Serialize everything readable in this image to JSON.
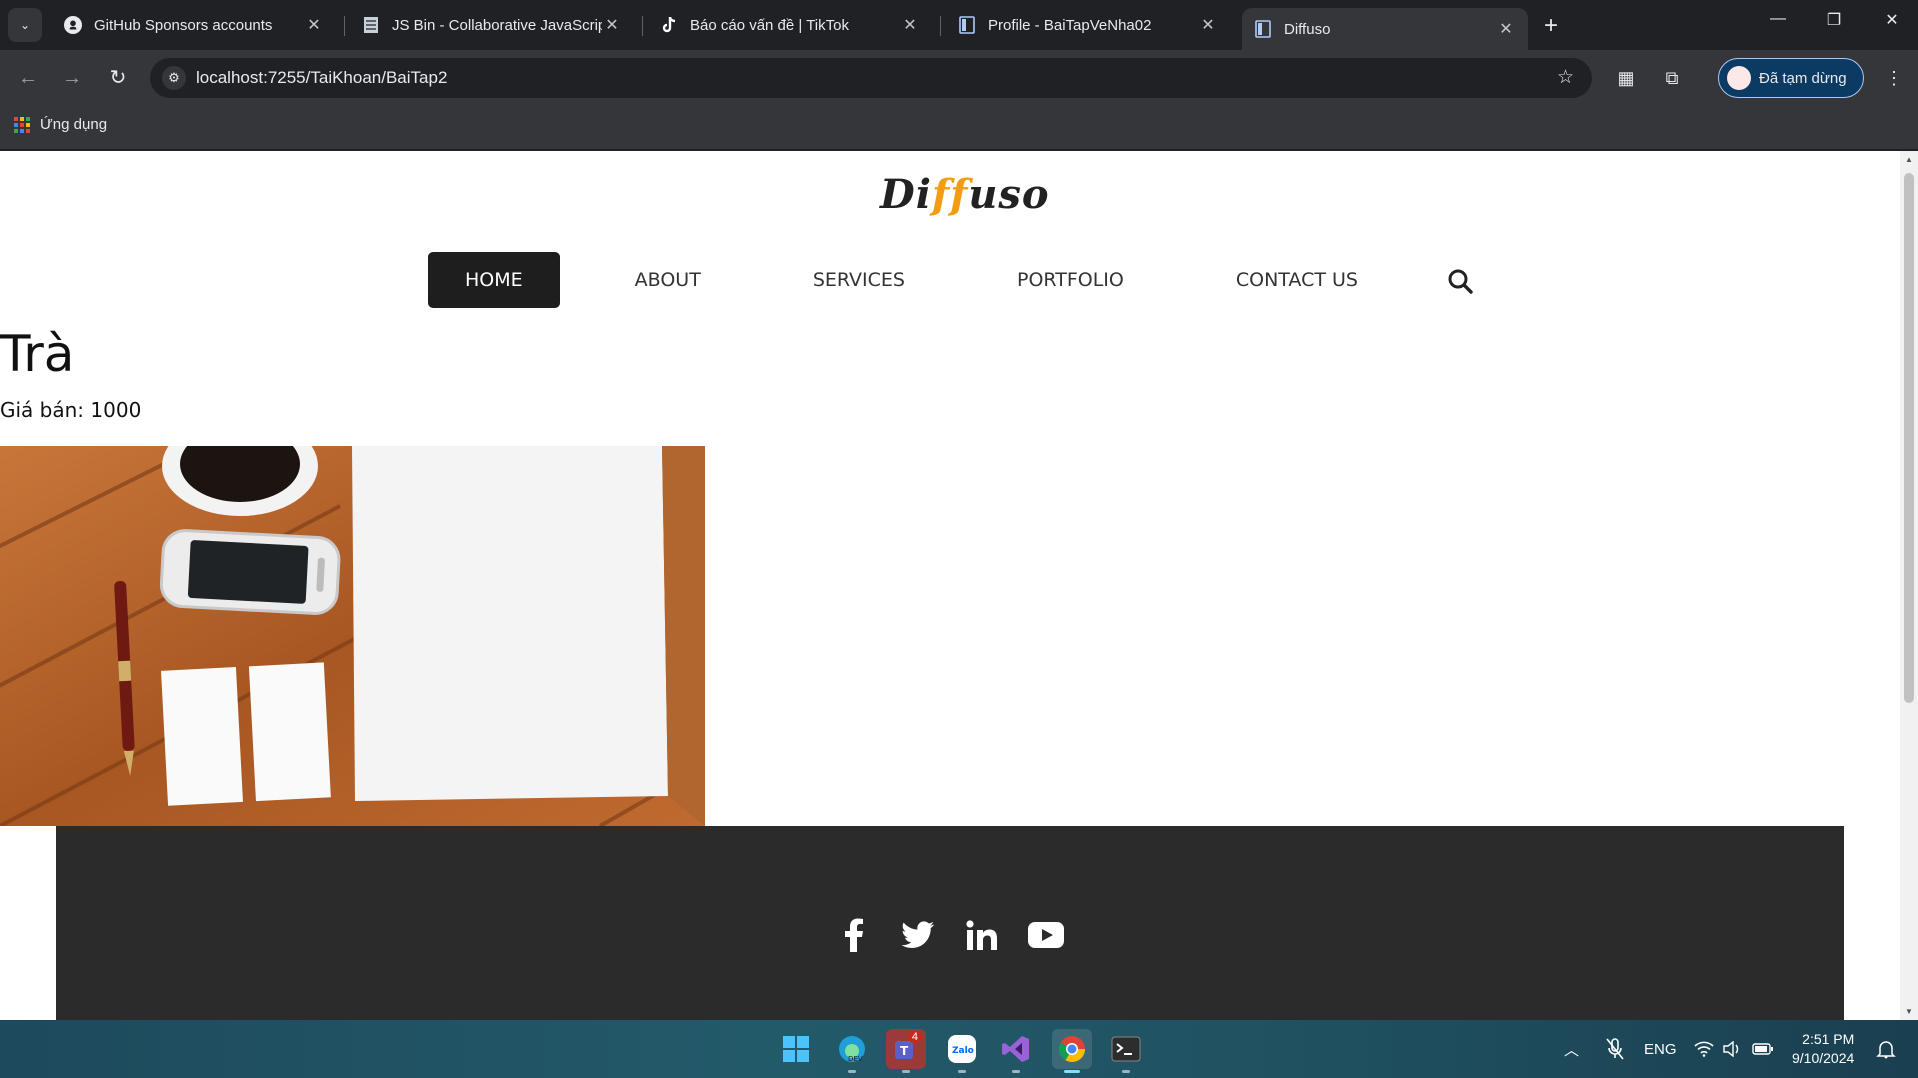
{
  "browser": {
    "tabs": [
      {
        "title": "GitHub Sponsors accounts",
        "icon": "github-icon"
      },
      {
        "title": "JS Bin - Collaborative JavaScript",
        "icon": "jsbin-icon"
      },
      {
        "title": "Báo cáo vấn đề | TikTok",
        "icon": "tiktok-icon"
      },
      {
        "title": "Profile - BaiTapVeNha02",
        "icon": "page-icon"
      },
      {
        "title": "Diffuso",
        "icon": "page-icon",
        "active": true
      }
    ],
    "url": "localhost:7255/TaiKhoan/BaiTap2",
    "profile_label": "Đã tạm dừng",
    "bookmarks": {
      "apps_label": "Ứng dụng"
    }
  },
  "site": {
    "logo_prefix": "Di",
    "logo_accent": "ff",
    "logo_suffix": "uso",
    "nav": [
      "HOME",
      "ABOUT",
      "SERVICES",
      "PORTFOLIO",
      "CONTACT US"
    ],
    "active_nav": "HOME",
    "accent_color": "#f39c12"
  },
  "product": {
    "name": "Trà",
    "price_label": "Giá bán: 1000"
  },
  "footer": {
    "social": [
      "facebook-icon",
      "twitter-icon",
      "linkedin-icon",
      "youtube-icon"
    ]
  },
  "taskbar": {
    "teams_badge": "4",
    "lang": "ENG",
    "time": "2:51 PM",
    "date": "9/10/2024"
  }
}
